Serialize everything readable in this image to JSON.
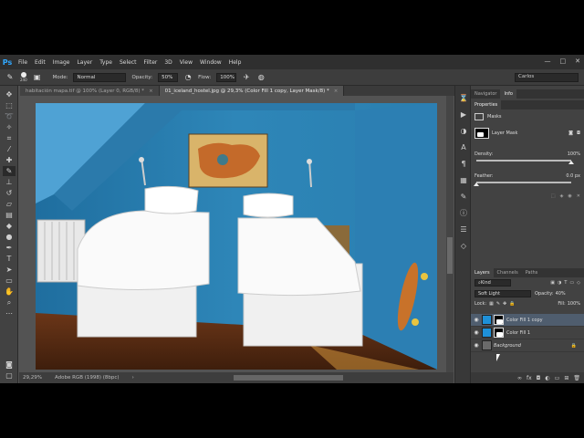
{
  "app": {
    "logo": "Ps"
  },
  "menu": [
    "File",
    "Edit",
    "Image",
    "Layer",
    "Type",
    "Select",
    "Filter",
    "3D",
    "View",
    "Window",
    "Help"
  ],
  "window_controls": [
    "—",
    "□",
    "✕"
  ],
  "options": {
    "brush_size": "240",
    "mode_label": "Mode:",
    "mode_value": "Normal",
    "opacity_label": "Opacity:",
    "opacity_value": "50%",
    "flow_label": "Flow:",
    "flow_value": "100%",
    "workspace": "Carlos"
  },
  "tabs": [
    {
      "label": "habitación mapa.tif @ 100% (Layer 0, RGB/8) *",
      "close": "×"
    },
    {
      "label": "01_iceland_hostel.jpg @ 29,3% (Color Fill 1 copy, Layer Mask/8) *",
      "close": "×"
    }
  ],
  "status": {
    "zoom": "29,29%",
    "profile": "Adobe RGB (1998) (8bpc)",
    "arrow": "›"
  },
  "panels": {
    "top_tabs": [
      "Navigator",
      "Info"
    ],
    "properties_tab": "Properties",
    "masks_label": "Masks",
    "layer_mask_label": "Layer Mask",
    "density_label": "Density:",
    "density_value": "100%",
    "density_level": 1.0,
    "feather_label": "Feather:",
    "feather_value": "0.0 px",
    "feather_level": 0.0,
    "layer_tabs": [
      "Layers",
      "Channels",
      "Paths"
    ],
    "kind_label": "Kind",
    "blend_mode": "Soft Light",
    "opacity_label": "Opacity:",
    "opacity_value": "40%",
    "lock_label": "Lock:",
    "fill_label": "Fill:",
    "fill_value": "100%",
    "layers": [
      {
        "name": "Color Fill 1 copy",
        "color": "#1e90d8",
        "selected": true
      },
      {
        "name": "Color Fill 1",
        "color": "#1e90d8",
        "selected": false
      },
      {
        "name": "Background",
        "color": "#6a6a6a",
        "selected": false
      }
    ],
    "bottom_icons": [
      "∞",
      "fx",
      "◘",
      "◐",
      "▭",
      "⊞",
      "🗑"
    ]
  },
  "colors": {
    "accent": "#31a8ff",
    "wall": "#2e83b5",
    "floor": "#5a2e14"
  }
}
